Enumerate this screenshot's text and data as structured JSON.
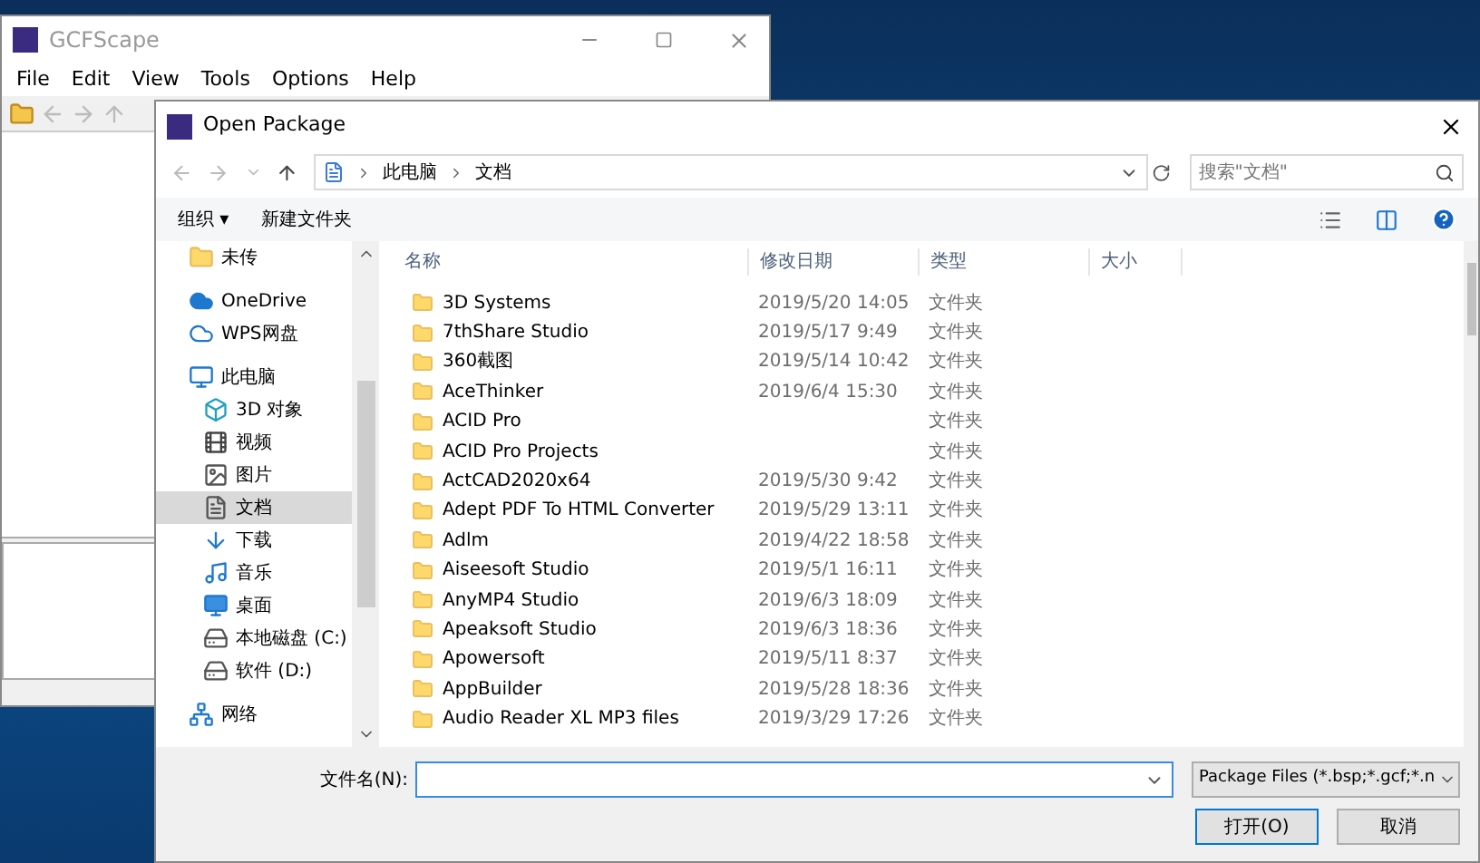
{
  "main_window": {
    "title": "GCFScape",
    "menu": [
      "File",
      "Edit",
      "View",
      "Tools",
      "Options",
      "Help"
    ]
  },
  "dialog": {
    "title": "Open Package",
    "breadcrumb": [
      "此电脑",
      "文档"
    ],
    "search": {
      "placeholder": "搜索\"文档\""
    },
    "toolbar": {
      "organize": "组织 ▾",
      "new_folder": "新建文件夹"
    },
    "nav": [
      {
        "label": "未传",
        "kind": "folder",
        "selected": false
      },
      {
        "label": "OneDrive",
        "kind": "cloud",
        "selected": false
      },
      {
        "label": "WPS网盘",
        "kind": "cloud-outline",
        "selected": false
      },
      {
        "label": "此电脑",
        "kind": "computer",
        "selected": false,
        "children": [
          {
            "label": "3D 对象",
            "kind": "cube",
            "selected": false
          },
          {
            "label": "视频",
            "kind": "film",
            "selected": false
          },
          {
            "label": "图片",
            "kind": "image",
            "selected": false
          },
          {
            "label": "文档",
            "kind": "document",
            "selected": true
          },
          {
            "label": "下载",
            "kind": "download",
            "selected": false
          },
          {
            "label": "音乐",
            "kind": "music",
            "selected": false
          },
          {
            "label": "桌面",
            "kind": "desktop",
            "selected": false
          },
          {
            "label": "本地磁盘 (C:)",
            "kind": "drive",
            "selected": false
          },
          {
            "label": "软件 (D:)",
            "kind": "drive",
            "selected": false
          }
        ]
      },
      {
        "label": "网络",
        "kind": "network",
        "selected": false
      }
    ],
    "columns": [
      "名称",
      "修改日期",
      "类型",
      "大小"
    ],
    "rows": [
      {
        "name": "3D Systems",
        "date": "2019/5/20 14:05",
        "type": "文件夹"
      },
      {
        "name": "7thShare Studio",
        "date": "2019/5/17 9:49",
        "type": "文件夹"
      },
      {
        "name": "360截图",
        "date": "2019/5/14 10:42",
        "type": "文件夹"
      },
      {
        "name": "AceThinker",
        "date": "2019/6/4 15:30",
        "type": "文件夹"
      },
      {
        "name": "ACID Pro",
        "type": "文件夹"
      },
      {
        "name": "ACID Pro Projects",
        "type": "文件夹"
      },
      {
        "name": "ActCAD2020x64",
        "date": "2019/5/30 9:42",
        "type": "文件夹"
      },
      {
        "name": "Adept PDF To HTML Converter",
        "date": "2019/5/29 13:11",
        "type": "文件夹"
      },
      {
        "name": "Adlm",
        "date": "2019/4/22 18:58",
        "type": "文件夹"
      },
      {
        "name": "Aiseesoft Studio",
        "date": "2019/5/1 16:11",
        "type": "文件夹"
      },
      {
        "name": "AnyMP4 Studio",
        "date": "2019/6/3 18:09",
        "type": "文件夹"
      },
      {
        "name": "Apeaksoft Studio",
        "date": "2019/6/3 18:36",
        "type": "文件夹"
      },
      {
        "name": "Apowersoft",
        "date": "2019/5/11 8:37",
        "type": "文件夹"
      },
      {
        "name": "AppBuilder",
        "date": "2019/5/28 18:36",
        "type": "文件夹"
      },
      {
        "name": "Audio Reader XL MP3 files",
        "date": "2019/3/29 17:26",
        "type": "文件夹"
      }
    ],
    "filename_label": "文件名(N):",
    "filetype": "Package Files (*.bsp;*.gcf;*.n",
    "buttons": [
      "打开(O)",
      "取消"
    ]
  }
}
